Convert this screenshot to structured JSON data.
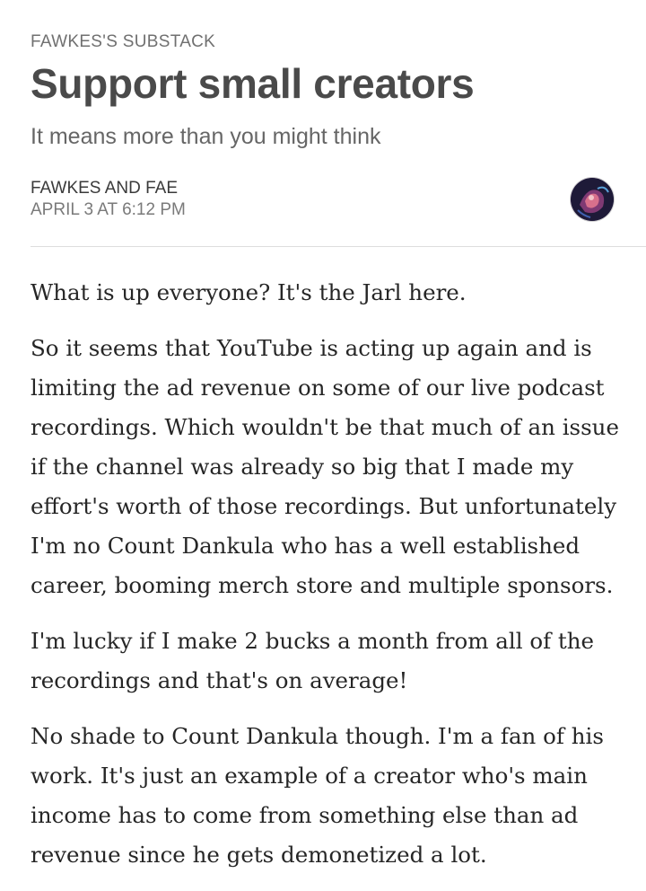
{
  "post": {
    "publication": "FAWKES'S SUBSTACK",
    "title": "Support small creators",
    "subtitle": "It means more than you might think",
    "author": "FAWKES AND FAE",
    "date": "APRIL 3 AT 6:12 PM",
    "avatar_icon": "author-avatar",
    "paragraphs": [
      "What is up everyone? It's the Jarl here.",
      "So it seems that YouTube is acting up again and is limiting the ad revenue on some of our live podcast recordings. Which wouldn't be that much of an issue if the channel was already so big that I made my effort's worth of those recordings. But unfortunately I'm no Count Dankula who has a well established career, booming merch store and multiple sponsors.",
      "I'm lucky if I make 2 bucks a month from all of the recordings and that's on average!",
      "No shade to Count Dankula though. I'm a fan of his work. It's just an example of a creator who's main income has to come from something else than ad revenue since he gets demonetized a lot."
    ]
  }
}
